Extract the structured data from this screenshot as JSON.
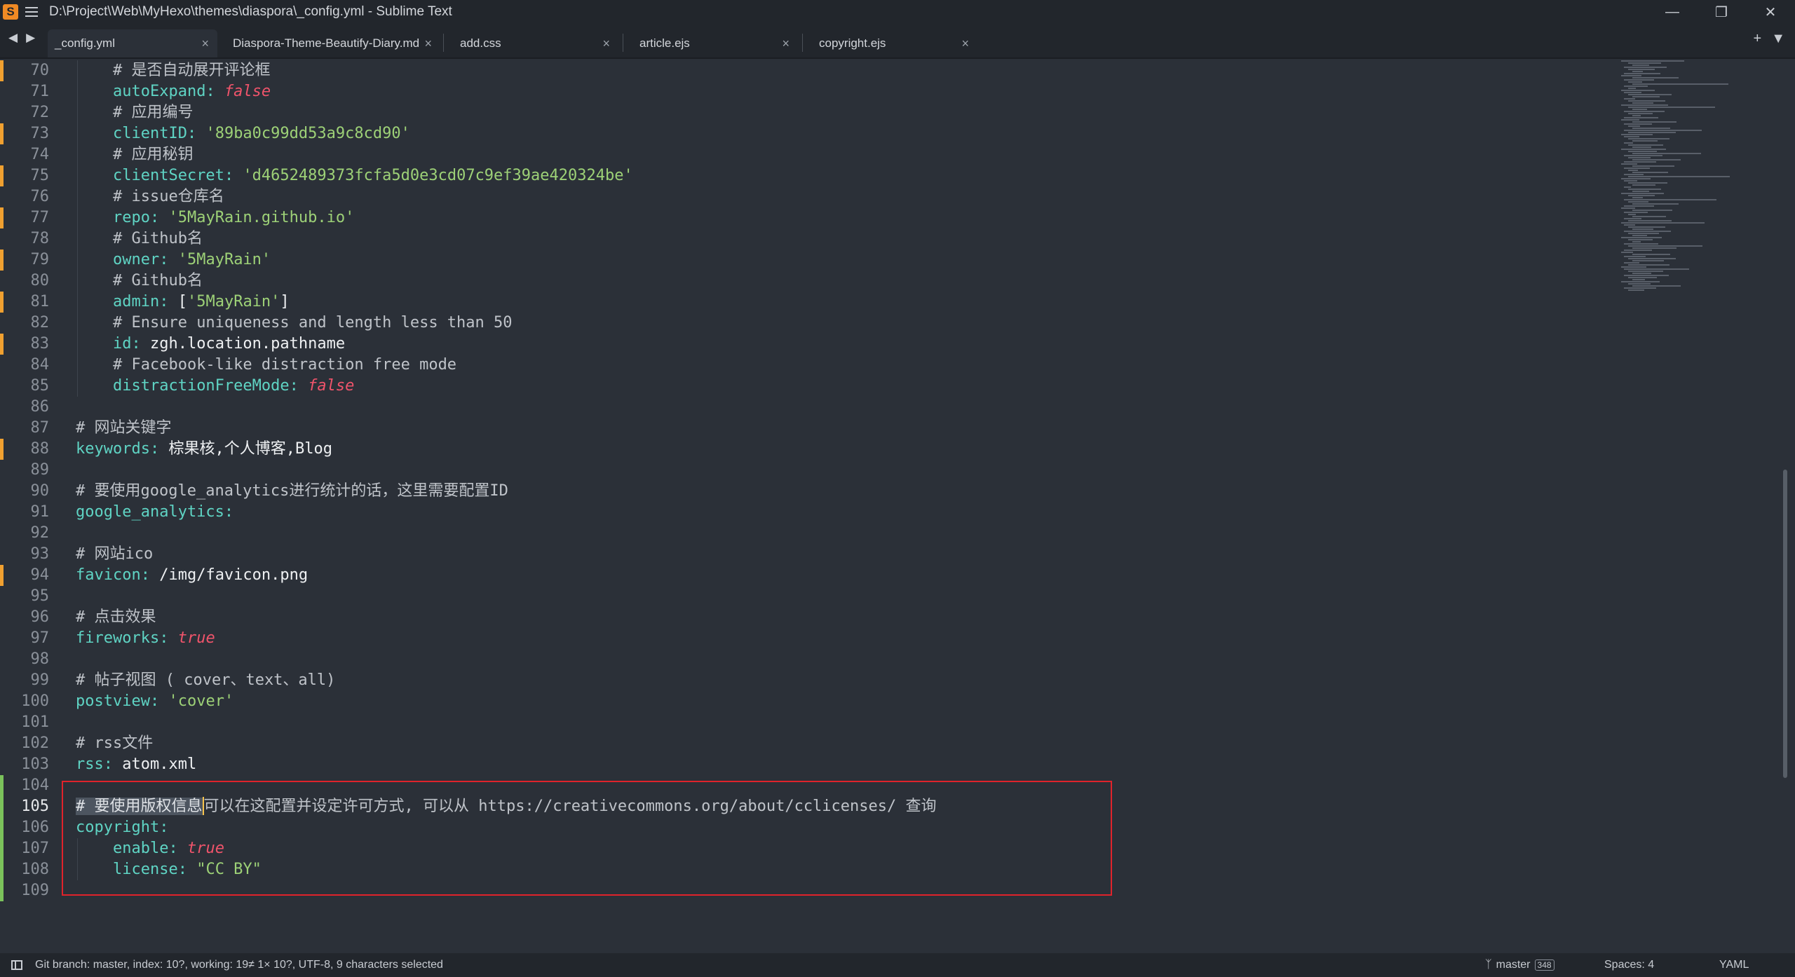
{
  "window": {
    "title": "D:\\Project\\Web\\MyHexo\\themes\\diaspora\\_config.yml - Sublime Text",
    "app_icon": "sublime-icon",
    "controls": [
      "minimize",
      "restore",
      "close"
    ]
  },
  "tabs": [
    {
      "label": "_config.yml",
      "active": true
    },
    {
      "label": "Diaspora-Theme-Beautify-Diary.md",
      "active": false
    },
    {
      "label": "add.css",
      "active": false
    },
    {
      "label": "article.ejs",
      "active": false
    },
    {
      "label": "copyright.ejs",
      "active": false
    }
  ],
  "tab_close_glyph": "×",
  "editor": {
    "current_line": 105,
    "lines": [
      {
        "n": "70",
        "mod": true,
        "tokens": [
          [
            "i1",
            ""
          ],
          [
            "c",
            "# 是否自动展开评论框"
          ]
        ]
      },
      {
        "n": "71",
        "mod": false,
        "tokens": [
          [
            "i1",
            ""
          ],
          [
            "k",
            "autoExpand"
          ],
          [
            "p",
            ": "
          ],
          [
            "b",
            "false"
          ]
        ]
      },
      {
        "n": "72",
        "mod": false,
        "tokens": [
          [
            "i1",
            ""
          ],
          [
            "c",
            "# 应用编号"
          ]
        ]
      },
      {
        "n": "73",
        "mod": true,
        "tokens": [
          [
            "i1",
            ""
          ],
          [
            "k",
            "clientID"
          ],
          [
            "p",
            ": "
          ],
          [
            "s",
            "'89ba0c99dd53a9c8cd90'"
          ]
        ]
      },
      {
        "n": "74",
        "mod": false,
        "tokens": [
          [
            "i1",
            ""
          ],
          [
            "c",
            "# 应用秘钥"
          ]
        ]
      },
      {
        "n": "75",
        "mod": true,
        "tokens": [
          [
            "i1",
            ""
          ],
          [
            "k",
            "clientSecret"
          ],
          [
            "p",
            ": "
          ],
          [
            "s",
            "'d4652489373fcfa5d0e3cd07c9ef39ae420324be'"
          ]
        ]
      },
      {
        "n": "76",
        "mod": false,
        "tokens": [
          [
            "i1",
            ""
          ],
          [
            "c",
            "# issue仓库名"
          ]
        ]
      },
      {
        "n": "77",
        "mod": true,
        "tokens": [
          [
            "i1",
            ""
          ],
          [
            "k",
            "repo"
          ],
          [
            "p",
            ": "
          ],
          [
            "s",
            "'5MayRain.github.io'"
          ]
        ]
      },
      {
        "n": "78",
        "mod": false,
        "tokens": [
          [
            "i1",
            ""
          ],
          [
            "c",
            "# Github名"
          ]
        ]
      },
      {
        "n": "79",
        "mod": true,
        "tokens": [
          [
            "i1",
            ""
          ],
          [
            "k",
            "owner"
          ],
          [
            "p",
            ": "
          ],
          [
            "s",
            "'5MayRain'"
          ]
        ]
      },
      {
        "n": "80",
        "mod": false,
        "tokens": [
          [
            "i1",
            ""
          ],
          [
            "c",
            "# Github名"
          ]
        ]
      },
      {
        "n": "81",
        "mod": true,
        "tokens": [
          [
            "i1",
            ""
          ],
          [
            "k",
            "admin"
          ],
          [
            "p",
            ": "
          ],
          [
            "x",
            "["
          ],
          [
            "s",
            "'5MayRain'"
          ],
          [
            "x",
            "]"
          ]
        ]
      },
      {
        "n": "82",
        "mod": false,
        "tokens": [
          [
            "i1",
            ""
          ],
          [
            "c",
            "# Ensure uniqueness and length less than 50"
          ]
        ]
      },
      {
        "n": "83",
        "mod": true,
        "tokens": [
          [
            "i1",
            ""
          ],
          [
            "k",
            "id"
          ],
          [
            "p",
            ": "
          ],
          [
            "x",
            "zgh.location.pathname"
          ]
        ]
      },
      {
        "n": "84",
        "mod": false,
        "tokens": [
          [
            "i1",
            ""
          ],
          [
            "c",
            "# Facebook-like distraction free mode"
          ]
        ]
      },
      {
        "n": "85",
        "mod": false,
        "tokens": [
          [
            "i1",
            ""
          ],
          [
            "k",
            "distractionFreeMode"
          ],
          [
            "p",
            ": "
          ],
          [
            "b",
            "false"
          ]
        ]
      },
      {
        "n": "86",
        "mod": false,
        "tokens": []
      },
      {
        "n": "87",
        "mod": false,
        "tokens": [
          [
            "c",
            "# 网站关键字"
          ]
        ]
      },
      {
        "n": "88",
        "mod": true,
        "tokens": [
          [
            "k",
            "keywords"
          ],
          [
            "p",
            ": "
          ],
          [
            "x",
            "棕果核,个人博客,Blog"
          ]
        ]
      },
      {
        "n": "89",
        "mod": false,
        "tokens": []
      },
      {
        "n": "90",
        "mod": false,
        "tokens": [
          [
            "c",
            "# 要使用google_analytics进行统计的话，这里需要配置ID"
          ]
        ]
      },
      {
        "n": "91",
        "mod": false,
        "tokens": [
          [
            "k",
            "google_analytics"
          ],
          [
            "p",
            ":"
          ]
        ]
      },
      {
        "n": "92",
        "mod": false,
        "tokens": []
      },
      {
        "n": "93",
        "mod": false,
        "tokens": [
          [
            "c",
            "# 网站ico"
          ]
        ]
      },
      {
        "n": "94",
        "mod": true,
        "tokens": [
          [
            "k",
            "favicon"
          ],
          [
            "p",
            ": "
          ],
          [
            "x",
            "/img/favicon.png"
          ]
        ]
      },
      {
        "n": "95",
        "mod": false,
        "tokens": []
      },
      {
        "n": "96",
        "mod": false,
        "tokens": [
          [
            "c",
            "# 点击效果"
          ]
        ]
      },
      {
        "n": "97",
        "mod": false,
        "tokens": [
          [
            "k",
            "fireworks"
          ],
          [
            "p",
            ": "
          ],
          [
            "b",
            "true"
          ]
        ]
      },
      {
        "n": "98",
        "mod": false,
        "tokens": []
      },
      {
        "n": "99",
        "mod": false,
        "tokens": [
          [
            "c",
            "# 帖子视图 ( cover、text、all)"
          ]
        ]
      },
      {
        "n": "100",
        "mod": false,
        "tokens": [
          [
            "k",
            "postview"
          ],
          [
            "p",
            ": "
          ],
          [
            "s",
            "'cover'"
          ]
        ]
      },
      {
        "n": "101",
        "mod": false,
        "tokens": []
      },
      {
        "n": "102",
        "mod": false,
        "tokens": [
          [
            "c",
            "# rss文件"
          ]
        ]
      },
      {
        "n": "103",
        "mod": false,
        "tokens": [
          [
            "k",
            "rss"
          ],
          [
            "p",
            ": "
          ],
          [
            "x",
            "atom.xml"
          ]
        ]
      },
      {
        "n": "104",
        "mod": false,
        "tokens": []
      },
      {
        "n": "105",
        "mod": false,
        "tokens": [
          [
            "sel",
            "# 要使用版权信息"
          ],
          [
            "cur",
            ""
          ],
          [
            "c",
            "可以在这配置并设定许可方式, 可以从 https://creativecommons.org/about/cclicenses/ 查询"
          ]
        ]
      },
      {
        "n": "106",
        "mod": false,
        "tokens": [
          [
            "k",
            "copyright"
          ],
          [
            "p",
            ":"
          ]
        ]
      },
      {
        "n": "107",
        "mod": false,
        "tokens": [
          [
            "i1",
            ""
          ],
          [
            "k",
            "enable"
          ],
          [
            "p",
            ": "
          ],
          [
            "b",
            "true"
          ]
        ]
      },
      {
        "n": "108",
        "mod": false,
        "tokens": [
          [
            "i1",
            ""
          ],
          [
            "k",
            "license"
          ],
          [
            "p",
            ": "
          ],
          [
            "s",
            "\"CC BY\""
          ]
        ]
      },
      {
        "n": "109",
        "mod": false,
        "tokens": []
      }
    ]
  },
  "colors": {
    "modified_marker": "#f0a030",
    "added_marker": "#7bc25b",
    "highlight_box": "#e0232b"
  },
  "statusbar": {
    "left_text": "Git branch: master, index: 10?, working: 19≠ 1× 10?, UTF-8, 9 characters selected",
    "branch_name": "master",
    "branch_count": "348",
    "spaces": "Spaces: 4",
    "syntax": "YAML"
  }
}
